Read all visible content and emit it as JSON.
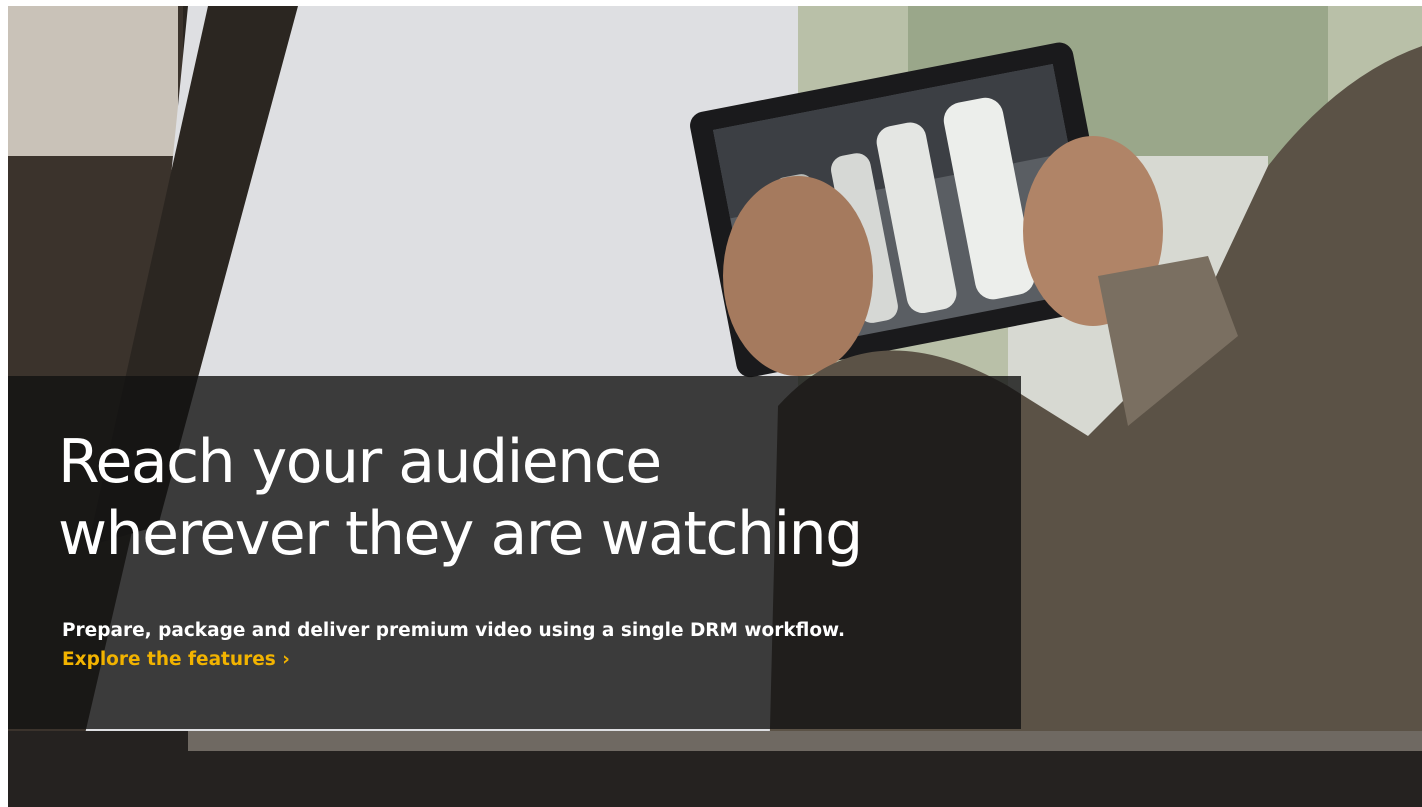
{
  "hero": {
    "headline_line1": "Reach your audience",
    "headline_line2": "wherever they are watching",
    "subtext": "Prepare, package and deliver premium video using a single DRM workflow.",
    "cta_label": "Explore the features ›",
    "cta_color": "#f2b300"
  }
}
